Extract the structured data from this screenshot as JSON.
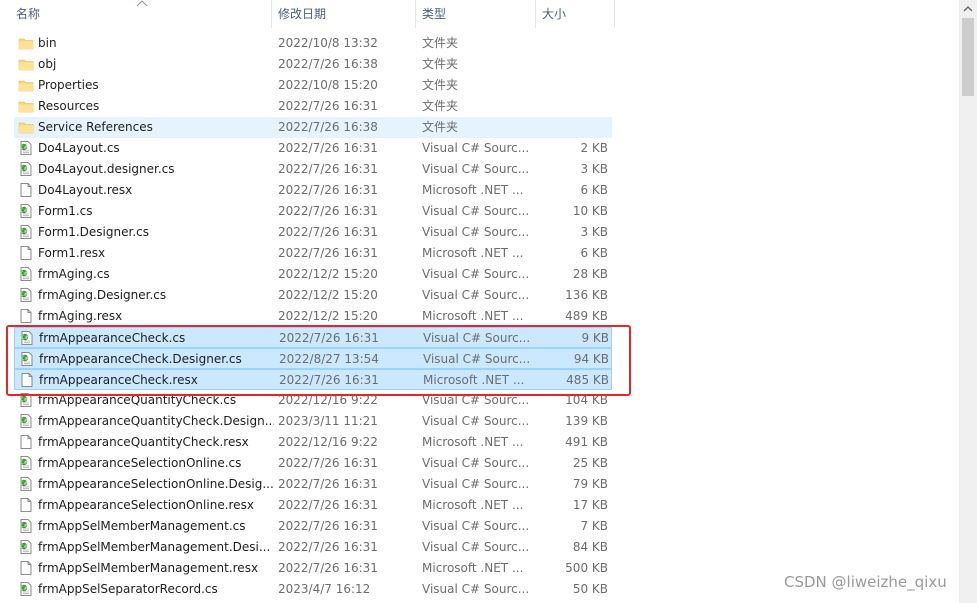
{
  "columns": {
    "name": "名称",
    "date": "修改日期",
    "type": "类型",
    "size": "大小"
  },
  "files": [
    {
      "name": "bin",
      "date": "2022/10/8 13:32",
      "type": "文件夹",
      "size": "",
      "icon": "folder-icon"
    },
    {
      "name": "obj",
      "date": "2022/7/26 16:38",
      "type": "文件夹",
      "size": "",
      "icon": "folder-icon"
    },
    {
      "name": "Properties",
      "date": "2022/10/8 15:20",
      "type": "文件夹",
      "size": "",
      "icon": "folder-icon"
    },
    {
      "name": "Resources",
      "date": "2022/7/26 16:31",
      "type": "文件夹",
      "size": "",
      "icon": "folder-icon"
    },
    {
      "name": "Service References",
      "date": "2022/7/26 16:38",
      "type": "文件夹",
      "size": "",
      "icon": "folder-icon",
      "state": "hover"
    },
    {
      "name": "Do4Layout.cs",
      "date": "2022/7/26 16:31",
      "type": "Visual C# Sourc...",
      "size": "2 KB",
      "icon": "csharp-file-icon"
    },
    {
      "name": "Do4Layout.designer.cs",
      "date": "2022/7/26 16:31",
      "type": "Visual C# Sourc...",
      "size": "3 KB",
      "icon": "csharp-file-icon"
    },
    {
      "name": "Do4Layout.resx",
      "date": "2022/7/26 16:31",
      "type": "Microsoft .NET ...",
      "size": "6 KB",
      "icon": "resx-file-icon"
    },
    {
      "name": "Form1.cs",
      "date": "2022/7/26 16:31",
      "type": "Visual C# Sourc...",
      "size": "10 KB",
      "icon": "csharp-file-icon"
    },
    {
      "name": "Form1.Designer.cs",
      "date": "2022/7/26 16:31",
      "type": "Visual C# Sourc...",
      "size": "3 KB",
      "icon": "csharp-file-icon"
    },
    {
      "name": "Form1.resx",
      "date": "2022/7/26 16:31",
      "type": "Microsoft .NET ...",
      "size": "6 KB",
      "icon": "resx-file-icon"
    },
    {
      "name": "frmAging.cs",
      "date": "2022/12/2 15:20",
      "type": "Visual C# Sourc...",
      "size": "28 KB",
      "icon": "csharp-file-icon"
    },
    {
      "name": "frmAging.Designer.cs",
      "date": "2022/12/2 15:20",
      "type": "Visual C# Sourc...",
      "size": "136 KB",
      "icon": "csharp-file-icon"
    },
    {
      "name": "frmAging.resx",
      "date": "2022/12/2 15:20",
      "type": "Microsoft .NET ...",
      "size": "489 KB",
      "icon": "resx-file-icon"
    },
    {
      "name": "frmAppearanceCheck.cs",
      "date": "2022/7/26 16:31",
      "type": "Visual C# Sourc...",
      "size": "9 KB",
      "icon": "csharp-file-icon",
      "state": "selected"
    },
    {
      "name": "frmAppearanceCheck.Designer.cs",
      "date": "2022/8/27 13:54",
      "type": "Visual C# Sourc...",
      "size": "94 KB",
      "icon": "csharp-file-icon",
      "state": "selected"
    },
    {
      "name": "frmAppearanceCheck.resx",
      "date": "2022/7/26 16:31",
      "type": "Microsoft .NET ...",
      "size": "485 KB",
      "icon": "resx-file-icon",
      "state": "selected"
    },
    {
      "name": "frmAppearanceQuantityCheck.cs",
      "date": "2022/12/16 9:22",
      "type": "Visual C# Sourc...",
      "size": "104 KB",
      "icon": "csharp-file-icon"
    },
    {
      "name": "frmAppearanceQuantityCheck.Design...",
      "date": "2023/3/11 11:21",
      "type": "Visual C# Sourc...",
      "size": "139 KB",
      "icon": "csharp-file-icon"
    },
    {
      "name": "frmAppearanceQuantityCheck.resx",
      "date": "2022/12/16 9:22",
      "type": "Microsoft .NET ...",
      "size": "491 KB",
      "icon": "resx-file-icon"
    },
    {
      "name": "frmAppearanceSelectionOnline.cs",
      "date": "2022/7/26 16:31",
      "type": "Visual C# Sourc...",
      "size": "25 KB",
      "icon": "csharp-file-icon"
    },
    {
      "name": "frmAppearanceSelectionOnline.Desig...",
      "date": "2022/7/26 16:31",
      "type": "Visual C# Sourc...",
      "size": "79 KB",
      "icon": "csharp-file-icon"
    },
    {
      "name": "frmAppearanceSelectionOnline.resx",
      "date": "2022/7/26 16:31",
      "type": "Microsoft .NET ...",
      "size": "17 KB",
      "icon": "resx-file-icon"
    },
    {
      "name": "frmAppSelMemberManagement.cs",
      "date": "2022/7/26 16:31",
      "type": "Visual C# Sourc...",
      "size": "7 KB",
      "icon": "csharp-file-icon"
    },
    {
      "name": "frmAppSelMemberManagement.Desi...",
      "date": "2022/7/26 16:31",
      "type": "Visual C# Sourc...",
      "size": "84 KB",
      "icon": "csharp-file-icon"
    },
    {
      "name": "frmAppSelMemberManagement.resx",
      "date": "2022/7/26 16:31",
      "type": "Microsoft .NET ...",
      "size": "500 KB",
      "icon": "resx-file-icon"
    },
    {
      "name": "frmAppSelSeparatorRecord.cs",
      "date": "2023/4/7 16:12",
      "type": "Visual C# Sourc...",
      "size": "50 KB",
      "icon": "csharp-file-icon"
    }
  ],
  "watermark": "CSDN @liweizhe_qixu",
  "colors": {
    "selected": "#cce8ff",
    "hover": "#e5f3ff",
    "annotation": "#e8252a",
    "folder": "#f8d775"
  }
}
